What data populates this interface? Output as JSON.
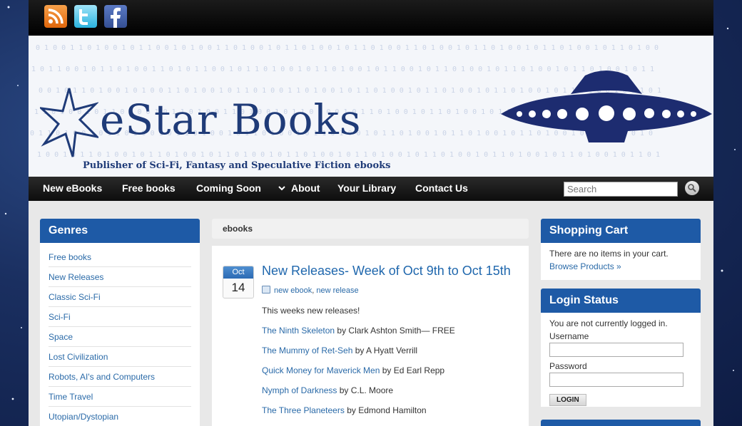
{
  "social": {
    "rss_icon": "rss-icon",
    "twitter_icon": "twitter-icon",
    "facebook_icon": "facebook-icon",
    "colors": {
      "rss": "#e87a1e",
      "twitter": "#4cc1ea",
      "facebook": "#3b5998"
    }
  },
  "header": {
    "logo_text": "eStar Books",
    "tagline": "Publisher of Sci-Fi, Fantasy and Speculative Fiction ebooks"
  },
  "nav": {
    "items": [
      "New eBooks",
      "Free books",
      "Coming Soon",
      "About",
      "Your Library",
      "Contact Us"
    ],
    "search_placeholder": "Search"
  },
  "genres": {
    "title": "Genres",
    "items": [
      "Free books",
      "New Releases",
      "Classic Sci-Fi",
      "Sci-Fi",
      "Space",
      "Lost Civilization",
      "Robots, AI's and Computers",
      "Time Travel",
      "Utopian/Dystopian"
    ]
  },
  "main": {
    "breadcrumb": "ebooks",
    "post": {
      "month": "Oct",
      "day": "14",
      "title": "New Releases- Week of Oct 9th to Oct 15th",
      "tags": [
        "new ebook",
        "new release"
      ],
      "intro": "This weeks new releases!",
      "books": [
        {
          "title": "The Ninth Skeleton",
          "byline": " by Clark Ashton Smith— FREE"
        },
        {
          "title": "The Mummy of Ret-Seh",
          "byline": " by A Hyatt Verrill"
        },
        {
          "title": "Quick Money for Maverick Men",
          "byline": " by Ed Earl Repp"
        },
        {
          "title": "Nymph of Darkness",
          "byline": " by C.L. Moore"
        },
        {
          "title": "The Three Planeteers",
          "byline": " by Edmond Hamilton"
        }
      ]
    }
  },
  "cart": {
    "title": "Shopping Cart",
    "empty_text": "There are no items in your cart.",
    "browse_link": "Browse Products »"
  },
  "login": {
    "title": "Login Status",
    "status_text": "You are not currently logged in.",
    "username_label": "Username",
    "password_label": "Password",
    "button_label": "LOGIN"
  },
  "theme": {
    "accent": "#1e5aa6",
    "link": "#2a6aa8",
    "nav_bg": "#111111"
  }
}
